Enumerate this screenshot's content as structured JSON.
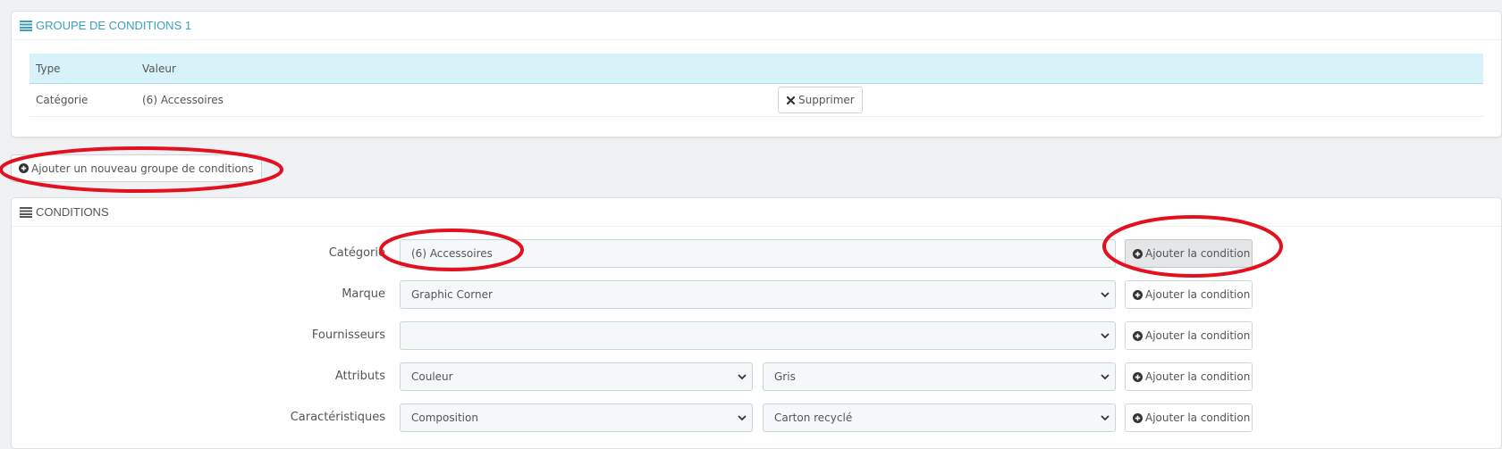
{
  "group_panel": {
    "title": "GROUPE DE CONDITIONS 1",
    "table": {
      "headers": [
        "Type",
        "Valeur"
      ],
      "rows": [
        {
          "type": "Catégorie",
          "value": "(6) Accessoires",
          "action": "Supprimer"
        }
      ]
    }
  },
  "add_group_button": "Ajouter un nouveau groupe de conditions",
  "conditions_panel": {
    "title": "CONDITIONS",
    "rows": [
      {
        "label": "Catégorie",
        "selects": [
          "(6) Accessoires"
        ],
        "button": "Ajouter la condition"
      },
      {
        "label": "Marque",
        "selects": [
          "Graphic Corner"
        ],
        "button": "Ajouter la condition"
      },
      {
        "label": "Fournisseurs",
        "selects": [
          ""
        ],
        "button": "Ajouter la condition"
      },
      {
        "label": "Attributs",
        "selects": [
          "Couleur",
          "Gris"
        ],
        "button": "Ajouter la condition"
      },
      {
        "label": "Caractéristiques",
        "selects": [
          "Composition",
          "Carton recyclé"
        ],
        "button": "Ajouter la condition"
      }
    ]
  },
  "colors": {
    "accent": "#3a9fbf",
    "table_header_bg": "#d8f2fa",
    "annotation": "#e3101f"
  },
  "icons": {
    "heading": "list-icon",
    "remove": "times-icon",
    "add": "plus-circle-icon",
    "select": "chevron-down-icon"
  }
}
